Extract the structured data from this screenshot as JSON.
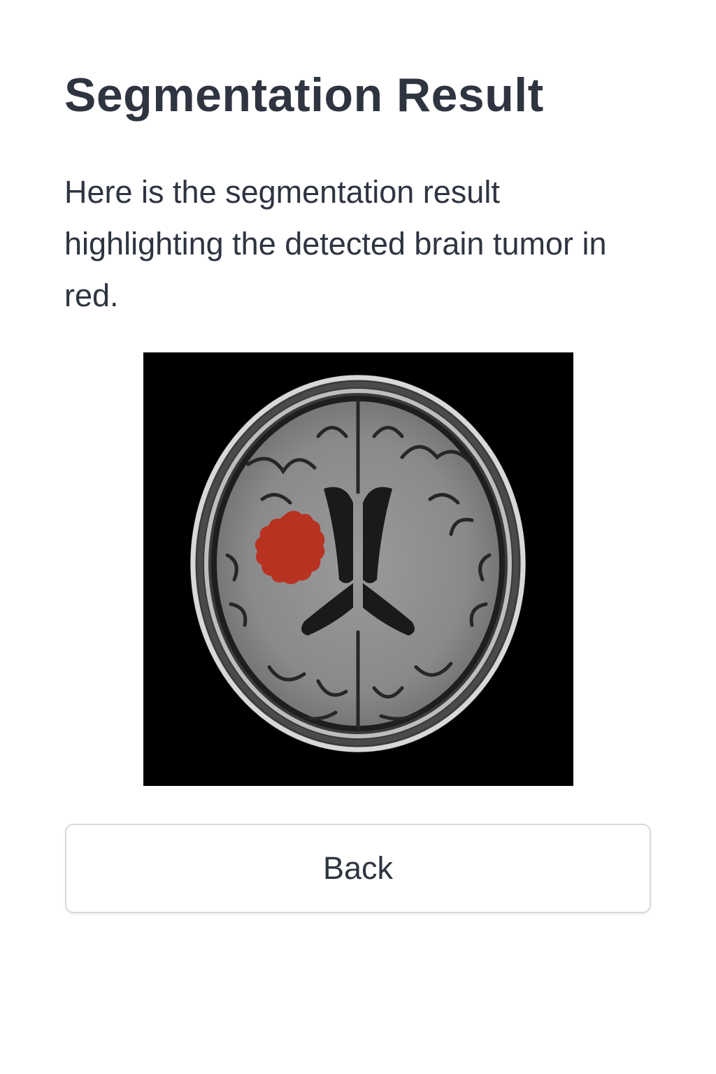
{
  "page": {
    "title": "Segmentation Result",
    "description": "Here is the segmentation result highlighting the detected brain tumor in red."
  },
  "scan": {
    "background_color": "#000000",
    "tumor_overlay_color": "#b83222"
  },
  "actions": {
    "back_label": "Back"
  }
}
